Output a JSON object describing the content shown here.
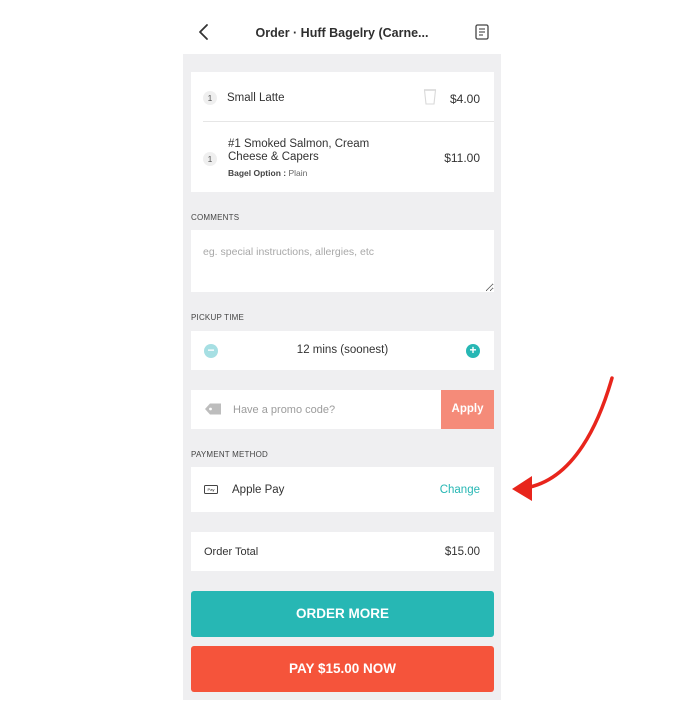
{
  "header": {
    "title": "Order · Huff Bagelry (Carne..."
  },
  "items": [
    {
      "qty": "1",
      "name": "Small Latte",
      "price": "$4.00"
    },
    {
      "qty": "1",
      "name_line1": "#1 Smoked Salmon, Cream",
      "name_line2": "Cheese & Capers",
      "option_label": "Bagel Option :",
      "option_value": "Plain",
      "price": "$11.00"
    }
  ],
  "comments": {
    "label": "COMMENTS",
    "placeholder": "eg. special instructions, allergies, etc"
  },
  "pickup": {
    "label": "PICKUP TIME",
    "minus": "−",
    "plus": "+",
    "value": "12 mins (soonest)"
  },
  "promo": {
    "placeholder": "Have a promo code?",
    "apply_label": "Apply"
  },
  "payment": {
    "label": "PAYMENT METHOD",
    "icon_text": "Pay",
    "method": "Apple Pay",
    "change_label": "Change"
  },
  "total": {
    "label": "Order Total",
    "value": "$15.00"
  },
  "buttons": {
    "order_more": "ORDER MORE",
    "pay_now": "PAY $15.00 NOW"
  },
  "colors": {
    "teal": "#27b7b4",
    "coral": "#f5543b",
    "apply": "#f58b79",
    "annotation": "#e8251c"
  },
  "icons": [
    "chevron-left-icon",
    "receipt-icon",
    "cup-icon",
    "tag-icon",
    "apple-pay-icon",
    "arrow-annotation"
  ]
}
